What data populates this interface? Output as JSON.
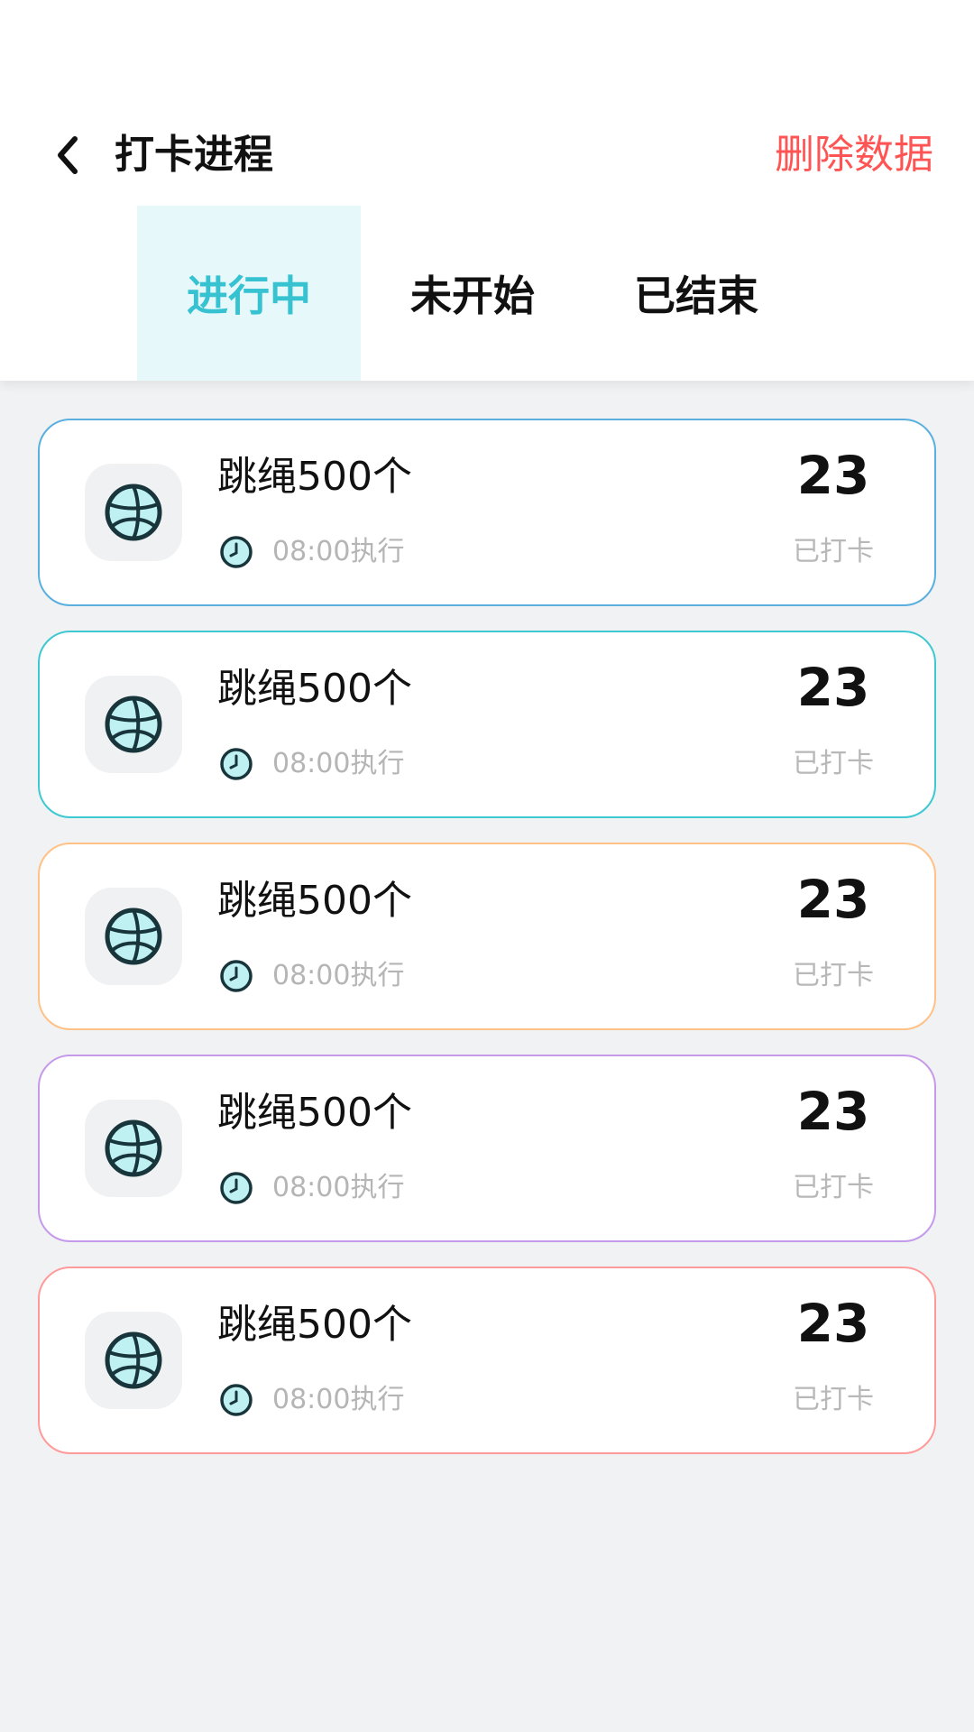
{
  "header": {
    "title": "打卡进程",
    "delete_label": "删除数据"
  },
  "tabs": [
    {
      "label": "进行中",
      "active": true
    },
    {
      "label": "未开始",
      "active": false
    },
    {
      "label": "已结束",
      "active": false
    }
  ],
  "colors": {
    "accent": "#36C2D1",
    "danger": "#FF5454",
    "card_borders": [
      "#5AAFDF",
      "#3EC8D2",
      "#FFC185",
      "#C59AEA",
      "#FF9A9A"
    ]
  },
  "tasks": [
    {
      "name": "跳绳500个",
      "time": "08:00执行",
      "count": "23",
      "status": "已打卡",
      "icon": "basketball-icon"
    },
    {
      "name": "跳绳500个",
      "time": "08:00执行",
      "count": "23",
      "status": "已打卡",
      "icon": "basketball-icon"
    },
    {
      "name": "跳绳500个",
      "time": "08:00执行",
      "count": "23",
      "status": "已打卡",
      "icon": "basketball-icon"
    },
    {
      "name": "跳绳500个",
      "time": "08:00执行",
      "count": "23",
      "status": "已打卡",
      "icon": "basketball-icon"
    },
    {
      "name": "跳绳500个",
      "time": "08:00执行",
      "count": "23",
      "status": "已打卡",
      "icon": "basketball-icon"
    }
  ]
}
